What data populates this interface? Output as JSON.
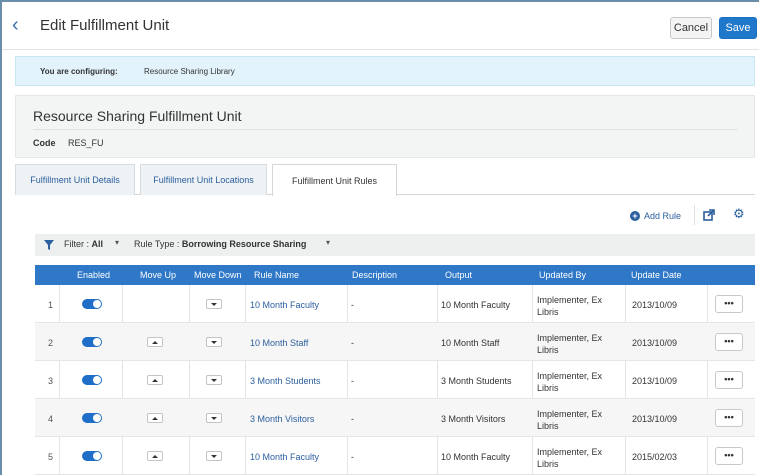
{
  "header": {
    "title": "Edit Fulfillment Unit",
    "cancel_label": "Cancel",
    "save_label": "Save"
  },
  "config": {
    "label": "You are configuring:",
    "value": "Resource Sharing Library"
  },
  "unit": {
    "name": "Resource Sharing Fulfillment Unit",
    "code_label": "Code",
    "code_value": "RES_FU"
  },
  "tabs": [
    {
      "label": "Fulfillment Unit Details"
    },
    {
      "label": "Fulfillment Unit Locations"
    },
    {
      "label": "Fulfillment Unit Rules"
    }
  ],
  "toolbar": {
    "add_rule_label": "Add Rule"
  },
  "filter": {
    "filter_label": "Filter :",
    "filter_value": "All",
    "rule_type_label": "Rule Type :",
    "rule_type_value": "Borrowing Resource Sharing"
  },
  "table": {
    "columns": [
      "Enabled",
      "Move Up",
      "Move Down",
      "Rule Name",
      "Description",
      "Output",
      "Updated By",
      "Update Date"
    ],
    "rows": [
      {
        "num": "1",
        "name": "10 Month Faculty",
        "description": "-",
        "output": "10 Month Faculty",
        "updated_by": "Implementer, Ex Libris",
        "date": "2013/10/09",
        "more": "•••"
      },
      {
        "num": "2",
        "name": "10 Month Staff",
        "description": "-",
        "output": "10 Month Staff",
        "updated_by": "Implementer, Ex Libris",
        "date": "2013/10/09",
        "more": "•••"
      },
      {
        "num": "3",
        "name": "3 Month Students",
        "description": "-",
        "output": "3 Month Students",
        "updated_by": "Implementer, Ex Libris",
        "date": "2013/10/09",
        "more": "•••"
      },
      {
        "num": "4",
        "name": "3 Month Visitors",
        "description": "-",
        "output": "3 Month Visitors",
        "updated_by": "Implementer, Ex Libris",
        "date": "2013/10/09",
        "more": "•••"
      },
      {
        "num": "5",
        "name": "10 Month Faculty",
        "description": "-",
        "output": "10 Month Faculty",
        "updated_by": "Implementer, Ex Libris",
        "date": "2015/02/03",
        "more": "•••"
      }
    ]
  },
  "colors": {
    "accent": "#1f78c9",
    "header_row": "#2f78c8",
    "banner": "#e3f3fb",
    "link": "#2b5f9e"
  }
}
